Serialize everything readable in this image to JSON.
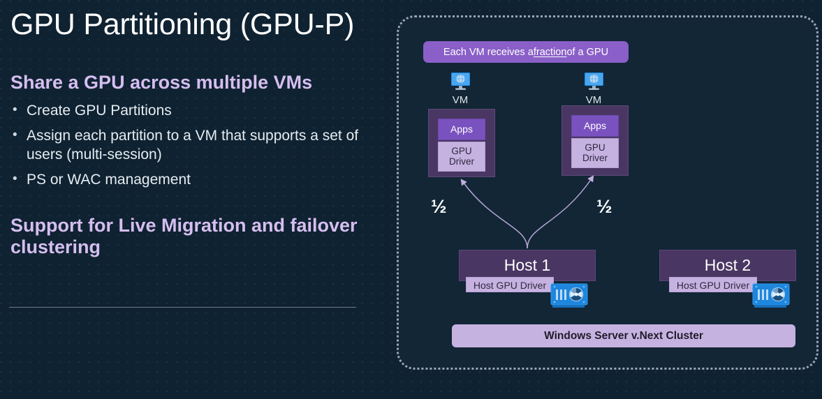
{
  "slide": {
    "title": "GPU Partitioning (GPU-P)",
    "background_color": "#0f2231"
  },
  "left": {
    "heading_1": "Share a GPU across multiple VMs",
    "bullets": [
      "Create GPU Partitions",
      "Assign each partition to a VM that supports a set of users (multi-session)",
      "PS or WAC management"
    ],
    "heading_2": "Support for Live Migration and failover clustering",
    "heading_color": "#d5bef0",
    "body_color": "#e6ecf1"
  },
  "diagram": {
    "callout": {
      "prefix": "Each VM receives a ",
      "emphasis": "fraction",
      "suffix": " of a GPU",
      "background_color": "#8a5fc8"
    },
    "vms": [
      {
        "icon": "vm-monitor-icon",
        "icon_label": "VM",
        "apps_label": "Apps",
        "driver_label_line1": "GPU",
        "driver_label_line2": "Driver",
        "fraction": "½"
      },
      {
        "icon": "vm-monitor-icon",
        "icon_label": "VM",
        "apps_label": "Apps",
        "driver_label_line1": "GPU",
        "driver_label_line2": "Driver",
        "fraction": "½"
      }
    ],
    "hosts": [
      {
        "title": "Host 1",
        "driver_label": "Host GPU Driver",
        "gpu_icon": "gpu-card-icon"
      },
      {
        "title": "Host 2",
        "driver_label": "Host GPU Driver",
        "gpu_icon": "gpu-card-icon"
      }
    ],
    "cluster_bar_label": "Windows Server v.Next Cluster",
    "colors": {
      "vm_box": "#4a3663",
      "apps_box": "#7a52bf",
      "driver_box": "#c6b2e0",
      "panel_background": "#122636",
      "panel_border": "#9aa7b8",
      "arrow": "#c3b0dd"
    }
  },
  "bullet_marker": "•"
}
